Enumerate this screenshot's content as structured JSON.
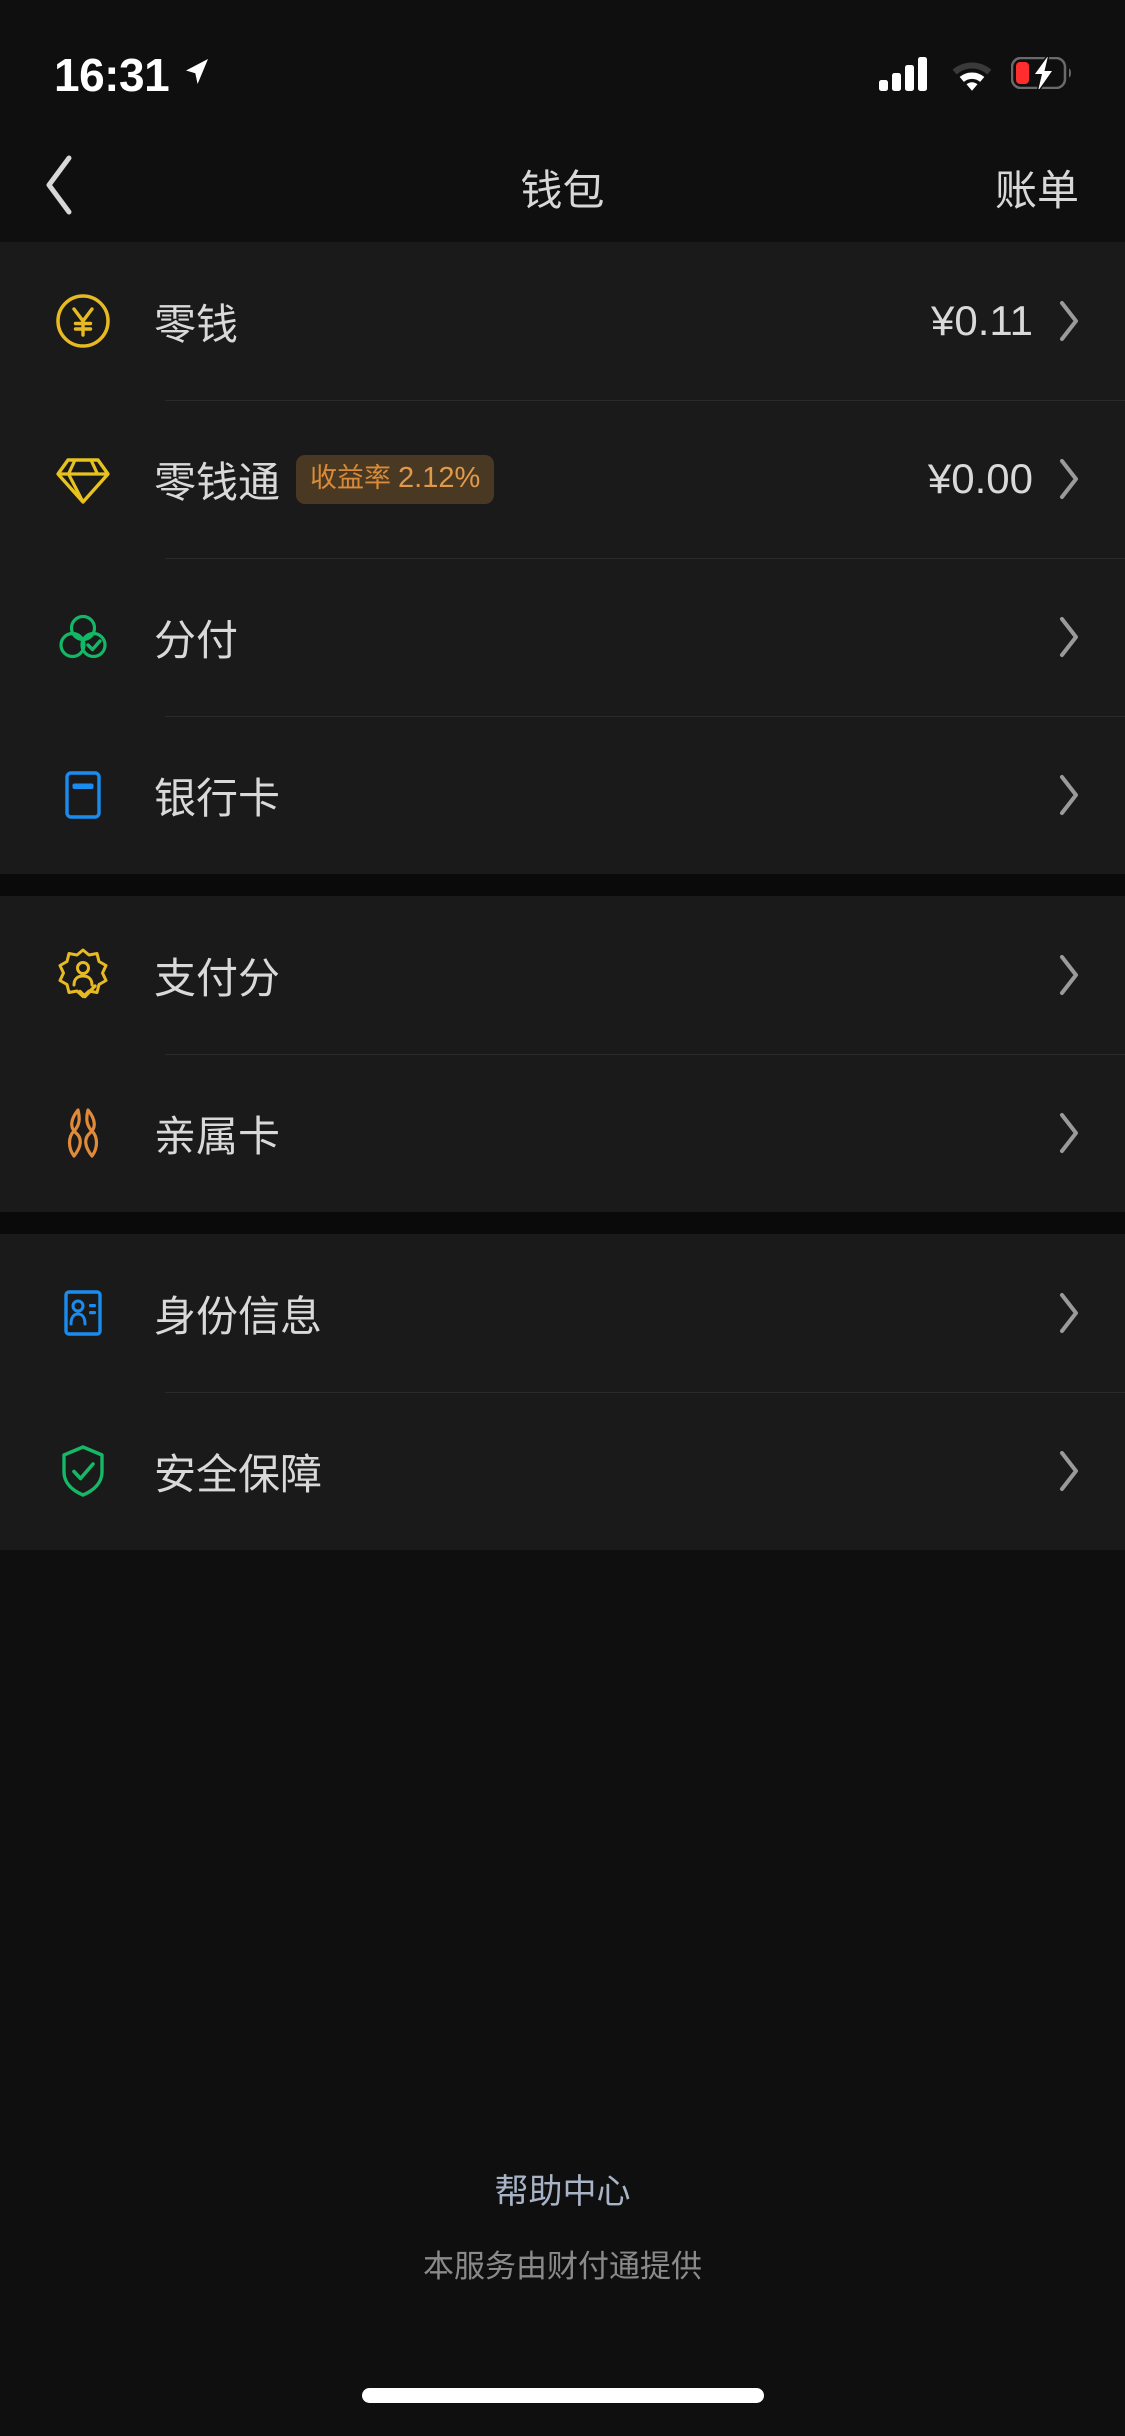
{
  "status_bar": {
    "time": "16:31",
    "icons": {
      "location": "location-arrow-icon",
      "signal": "cellular-signal-icon",
      "wifi": "wifi-icon",
      "battery": "battery-charging-low-icon"
    },
    "battery_color": "#ff2d2d"
  },
  "nav": {
    "back_icon": "chevron-left-icon",
    "title": "钱包",
    "right_action": "账单"
  },
  "sections": [
    {
      "rows": [
        {
          "icon": "yuan-coin-icon",
          "icon_color": "#e8ba22",
          "label": "零钱",
          "value": "¥0.11",
          "badge": null
        },
        {
          "icon": "diamond-icon",
          "icon_color": "#e8c21f",
          "label": "零钱通",
          "value": "¥0.00",
          "badge": {
            "label": "收益率",
            "value": "2.12%",
            "bg": "#4a3922",
            "fg": "#e0984a"
          }
        },
        {
          "icon": "three-circles-check-icon",
          "icon_color": "#12b866",
          "label": "分付",
          "value": "",
          "badge": null
        },
        {
          "icon": "bank-card-icon",
          "icon_color": "#1a8cf0",
          "label": "银行卡",
          "value": "",
          "badge": null
        }
      ]
    },
    {
      "rows": [
        {
          "icon": "payment-score-badge-icon",
          "icon_color": "#e8ba22",
          "label": "支付分",
          "value": "",
          "badge": null
        },
        {
          "icon": "family-card-icon",
          "icon_color": "#e08a3a",
          "label": "亲属卡",
          "value": "",
          "badge": null
        }
      ]
    },
    {
      "rows": [
        {
          "icon": "id-card-icon",
          "icon_color": "#1a8cf0",
          "label": "身份信息",
          "value": "",
          "badge": null
        },
        {
          "icon": "shield-check-icon",
          "icon_color": "#16b866",
          "label": "安全保障",
          "value": "",
          "badge": null
        }
      ]
    }
  ],
  "footer": {
    "help_link": "帮助中心",
    "provider_note": "本服务由财付通提供"
  },
  "home_indicator": "home-indicator-bar"
}
